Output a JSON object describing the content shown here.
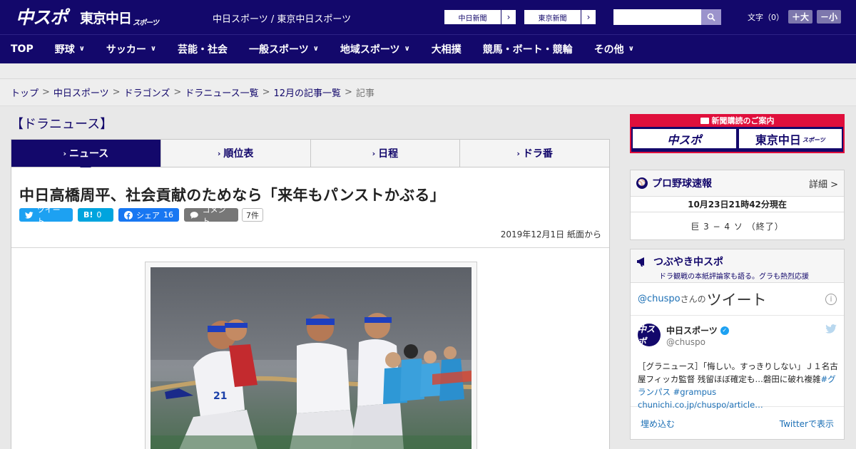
{
  "header": {
    "logo_primary": "中スポ",
    "logo_secondary": "東京中日",
    "logo_secondary_small": "スポーツ",
    "sites": "中日スポーツ / 東京中日スポーツ",
    "link_chunichi": "中日新聞",
    "link_tokyo": "東京新聞",
    "search_placeholder": "",
    "font_size_label": "文字（0）",
    "font_plus": "＋大",
    "font_minus": "－小"
  },
  "nav": [
    {
      "label": "TOP",
      "has_menu": false
    },
    {
      "label": "野球",
      "has_menu": true
    },
    {
      "label": "サッカー",
      "has_menu": true
    },
    {
      "label": "芸能・社会",
      "has_menu": false
    },
    {
      "label": "一般スポーツ",
      "has_menu": true
    },
    {
      "label": "地域スポーツ",
      "has_menu": true
    },
    {
      "label": "大相撲",
      "has_menu": false
    },
    {
      "label": "競馬・ボート・競輪",
      "has_menu": false
    },
    {
      "label": "その他",
      "has_menu": true
    }
  ],
  "breadcrumb": {
    "items": [
      "トップ",
      "中日スポーツ",
      "ドラゴンズ",
      "ドラニュース一覧",
      "12月の記事一覧"
    ],
    "current": "記事",
    "separator": ">"
  },
  "section_title": "【ドラニュース】",
  "tabs": [
    {
      "label": "ニュース",
      "active": true
    },
    {
      "label": "順位表",
      "active": false
    },
    {
      "label": "日程",
      "active": false
    },
    {
      "label": "ドラ番",
      "active": false
    }
  ],
  "article": {
    "title": "中日高橋周平、社会貢献のためなら「来年もパンストかぶる」",
    "share": {
      "tweet": "ツイート",
      "hatena": "B!",
      "hatena_count": "0",
      "facebook": "シェア",
      "facebook_count": "16",
      "comment": "コメント",
      "comment_count": "7件"
    },
    "date": "2019年12月1日 紙面から"
  },
  "sidebar": {
    "promo_title": "新聞購読のご案内",
    "promo_logo1": "中スポ",
    "promo_logo2": "東京中日",
    "promo_logo2_small": "スポーツ",
    "baseball": {
      "title": "プロ野球速報",
      "detail": "詳細 >",
      "updated": "10月23日21時42分現在",
      "score": "巨 3 − 4 ソ （終了）"
    },
    "tsubuyaki": {
      "title": "つぶやき中スポ",
      "subtitle": "ドラ観戦の本紙評論家も語る。グラも熱烈応援",
      "handle": "@chuspo",
      "handle_suffix": "さんの",
      "tweets_label": "ツイート",
      "tweet": {
        "name": "中日スポーツ",
        "screen_name": "@chuspo",
        "avatar_text": "中スポ",
        "text": "［グラニュース］「悔しい。すっきりしない」Ｊ１名古屋フィッカ監督 残留ほぼ確定も…磐田に破れ複雑",
        "hashtags": "#グランパス #grampus",
        "link": "chunichi.co.jp/chuspo/article…"
      },
      "embed": "埋め込む",
      "view_on": "Twitterで表示"
    }
  },
  "colors": {
    "brand": "#13086b",
    "accent_red": "#e00f3c",
    "twitter": "#1da1f2",
    "facebook": "#1877f2"
  }
}
